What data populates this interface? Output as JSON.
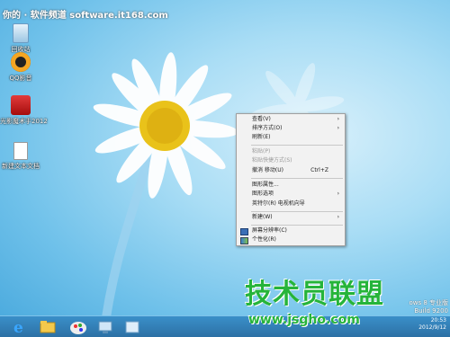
{
  "watermark_top": "你的 · 软件频道 software.it168.com",
  "desktop_icons": [
    {
      "label": "回收站",
      "icon": "recycle-bin-icon"
    },
    {
      "label": "QQ影音",
      "icon": "media-player-icon"
    },
    {
      "label": "光影魔术手2012",
      "icon": "photo-editor-icon"
    },
    {
      "label": "新建文本文档",
      "icon": "text-document-icon"
    }
  ],
  "context_menu": {
    "items": [
      {
        "label": "查看(V)",
        "arrow": "›",
        "disabled": false
      },
      {
        "label": "排序方式(O)",
        "arrow": "›",
        "disabled": false
      },
      {
        "label": "刷新(E)",
        "disabled": false
      },
      {
        "label": "粘贴(P)",
        "disabled": true
      },
      {
        "label": "粘贴快捷方式(S)",
        "disabled": true
      },
      {
        "label": "撤消 移动(U)",
        "shortcut": "Ctrl+Z",
        "disabled": false
      },
      {
        "label": "图形属性...",
        "disabled": false
      },
      {
        "label": "图形选项",
        "arrow": "›",
        "disabled": false
      },
      {
        "label": "英特尔(R) 电视机向导",
        "disabled": false
      },
      {
        "label": "新建(W)",
        "arrow": "›",
        "disabled": false
      },
      {
        "label": "屏幕分辨率(C)",
        "icon": "screen-resolution-icon",
        "disabled": false
      },
      {
        "label": "个性化(R)",
        "icon": "personalize-icon",
        "disabled": false
      }
    ]
  },
  "edition": {
    "line1": "ows 8 专业版",
    "line2": "Build 9200"
  },
  "tray": {
    "time": "20:53",
    "date": "2012/9/12"
  },
  "watermark_logo": "技术员联盟",
  "watermark_url": "www.jsgho.com",
  "taskbar_items": [
    "internet-explorer-icon",
    "file-explorer-icon",
    "paint-icon",
    "network-icon",
    "window-icon"
  ],
  "colors": {
    "menu_bg": "#f2f2f2",
    "taskbar": "#2c6fa3",
    "watermark_green": "#25b43a"
  }
}
